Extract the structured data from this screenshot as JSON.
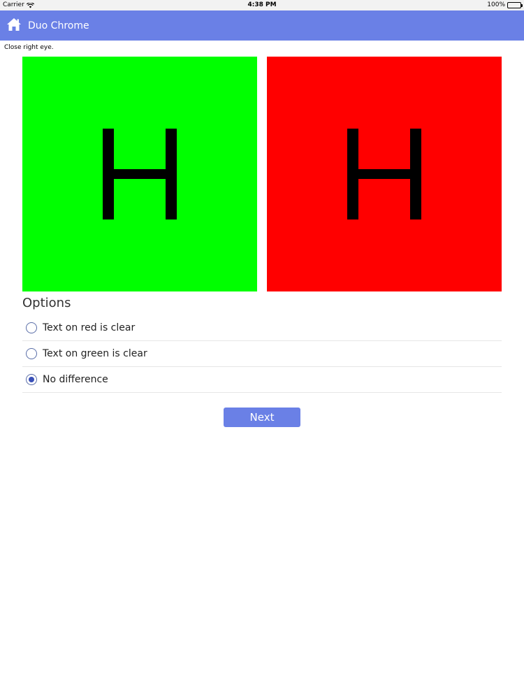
{
  "status_bar": {
    "carrier": "Carrier",
    "time": "4:38 PM",
    "battery": "100%"
  },
  "nav": {
    "title": "Duo Chrome",
    "home_icon": "home-icon"
  },
  "instruction": "Close right eye.",
  "panels": [
    {
      "letter": "H",
      "background": "#00ff00"
    },
    {
      "letter": "H",
      "background": "#ff0000"
    }
  ],
  "options": {
    "title": "Options",
    "items": [
      {
        "label": "Text on red is clear",
        "selected": false
      },
      {
        "label": "Text on green is clear",
        "selected": false
      },
      {
        "label": "No difference",
        "selected": true
      }
    ]
  },
  "next_button": {
    "label": "Next"
  },
  "colors": {
    "accent": "#6a80e6",
    "radio_selected": "#3a50b8"
  }
}
